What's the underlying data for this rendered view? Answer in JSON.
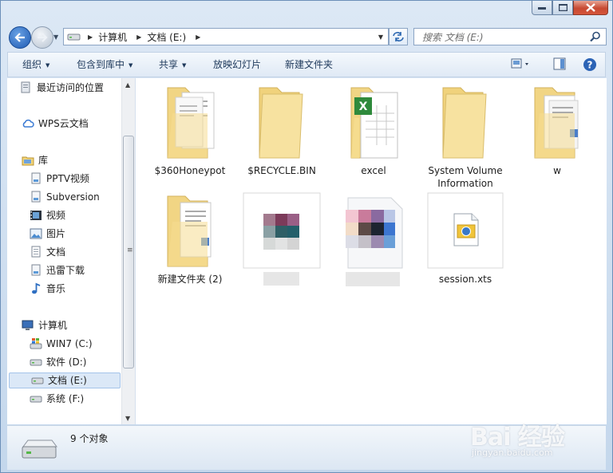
{
  "address": {
    "crumbs": [
      "计算机",
      "文档 (E:)"
    ],
    "search_placeholder": "搜索 文档 (E:)"
  },
  "toolbar": {
    "organize": "组织",
    "include_in_library": "包含到库中",
    "share": "共享",
    "slideshow": "放映幻灯片",
    "new_folder": "新建文件夹"
  },
  "sidebar": {
    "recent": "最近访问的位置",
    "wps_cloud": "WPS云文档",
    "libraries": "库",
    "library_items": [
      "PPTV视频",
      "Subversion",
      "视频",
      "图片",
      "文档",
      "迅雷下载",
      "音乐"
    ],
    "computer": "计算机",
    "drives": [
      "WIN7 (C:)",
      "软件 (D:)",
      "文档 (E:)",
      "系统 (F:)"
    ]
  },
  "files": [
    {
      "name": "$360Honeypot",
      "kind": "folder-docs"
    },
    {
      "name": "$RECYCLE.BIN",
      "kind": "folder"
    },
    {
      "name": "excel",
      "kind": "folder-excel"
    },
    {
      "name": "System Volume Information",
      "kind": "folder"
    },
    {
      "name": "w",
      "kind": "folder-docs"
    },
    {
      "name": "新建文件夹 (2)",
      "kind": "folder-docs"
    },
    {
      "name": "",
      "kind": "blurred"
    },
    {
      "name": "",
      "kind": "blurred"
    },
    {
      "name": "session.xts",
      "kind": "file"
    }
  ],
  "status": {
    "count": "9 个对象"
  },
  "watermark": {
    "brand": "Bai 经验",
    "url": "jingyan.baidu.com"
  },
  "colors": {
    "accent": "#1d5ab3",
    "selection": "#dbe8f7",
    "folder": "#f3d67f",
    "close": "#c74a33"
  }
}
